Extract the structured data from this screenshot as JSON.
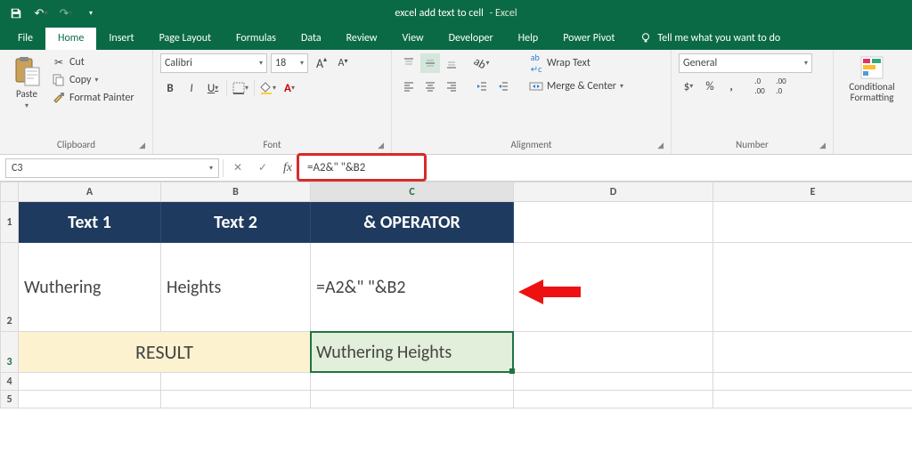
{
  "titlebar": {
    "doc_name": "excel add text to cell",
    "app_name": "-  Excel",
    "qat": {
      "save": "save",
      "undo": "undo",
      "redo": "redo"
    }
  },
  "tabs": {
    "file": "File",
    "home": "Home",
    "insert": "Insert",
    "page_layout": "Page Layout",
    "formulas": "Formulas",
    "data": "Data",
    "review": "Review",
    "view": "View",
    "developer": "Developer",
    "help": "Help",
    "power_pivot": "Power Pivot",
    "tell_me": "Tell me what you want to do"
  },
  "ribbon": {
    "clipboard": {
      "label": "Clipboard",
      "paste": "Paste",
      "cut": "Cut",
      "copy": "Copy",
      "format_painter": "Format Painter"
    },
    "font": {
      "label": "Font",
      "name": "Calibri",
      "size": "18",
      "bold": "B",
      "italic": "I",
      "underline": "U"
    },
    "alignment": {
      "label": "Alignment",
      "wrap_text": "Wrap Text",
      "merge_center": "Merge & Center"
    },
    "number": {
      "label": "Number",
      "format": "General",
      "currency": "$",
      "percent": "%",
      "comma": ","
    },
    "styles": {
      "cond_fmt": "Conditional Formatting"
    }
  },
  "formula_bar": {
    "name_box": "C3",
    "formula": "=A2&\" \"&B2"
  },
  "grid": {
    "cols": [
      "A",
      "B",
      "C",
      "D",
      "E"
    ],
    "rows": [
      "1",
      "2",
      "3",
      "4",
      "5"
    ],
    "header_row": {
      "a": "Text 1",
      "b": "Text 2",
      "c": "& OPERATOR"
    },
    "row2": {
      "a": "Wuthering",
      "b": "Heights",
      "c": "=A2&\" \"&B2"
    },
    "row3": {
      "ab": "RESULT",
      "c": "Wuthering Heights"
    }
  },
  "chart_data": {
    "type": "table",
    "columns": [
      "Text 1",
      "Text 2",
      "& OPERATOR"
    ],
    "rows": [
      [
        "Wuthering",
        "Heights",
        "=A2&\" \"&B2"
      ],
      [
        "RESULT",
        "",
        "Wuthering Heights"
      ]
    ]
  }
}
